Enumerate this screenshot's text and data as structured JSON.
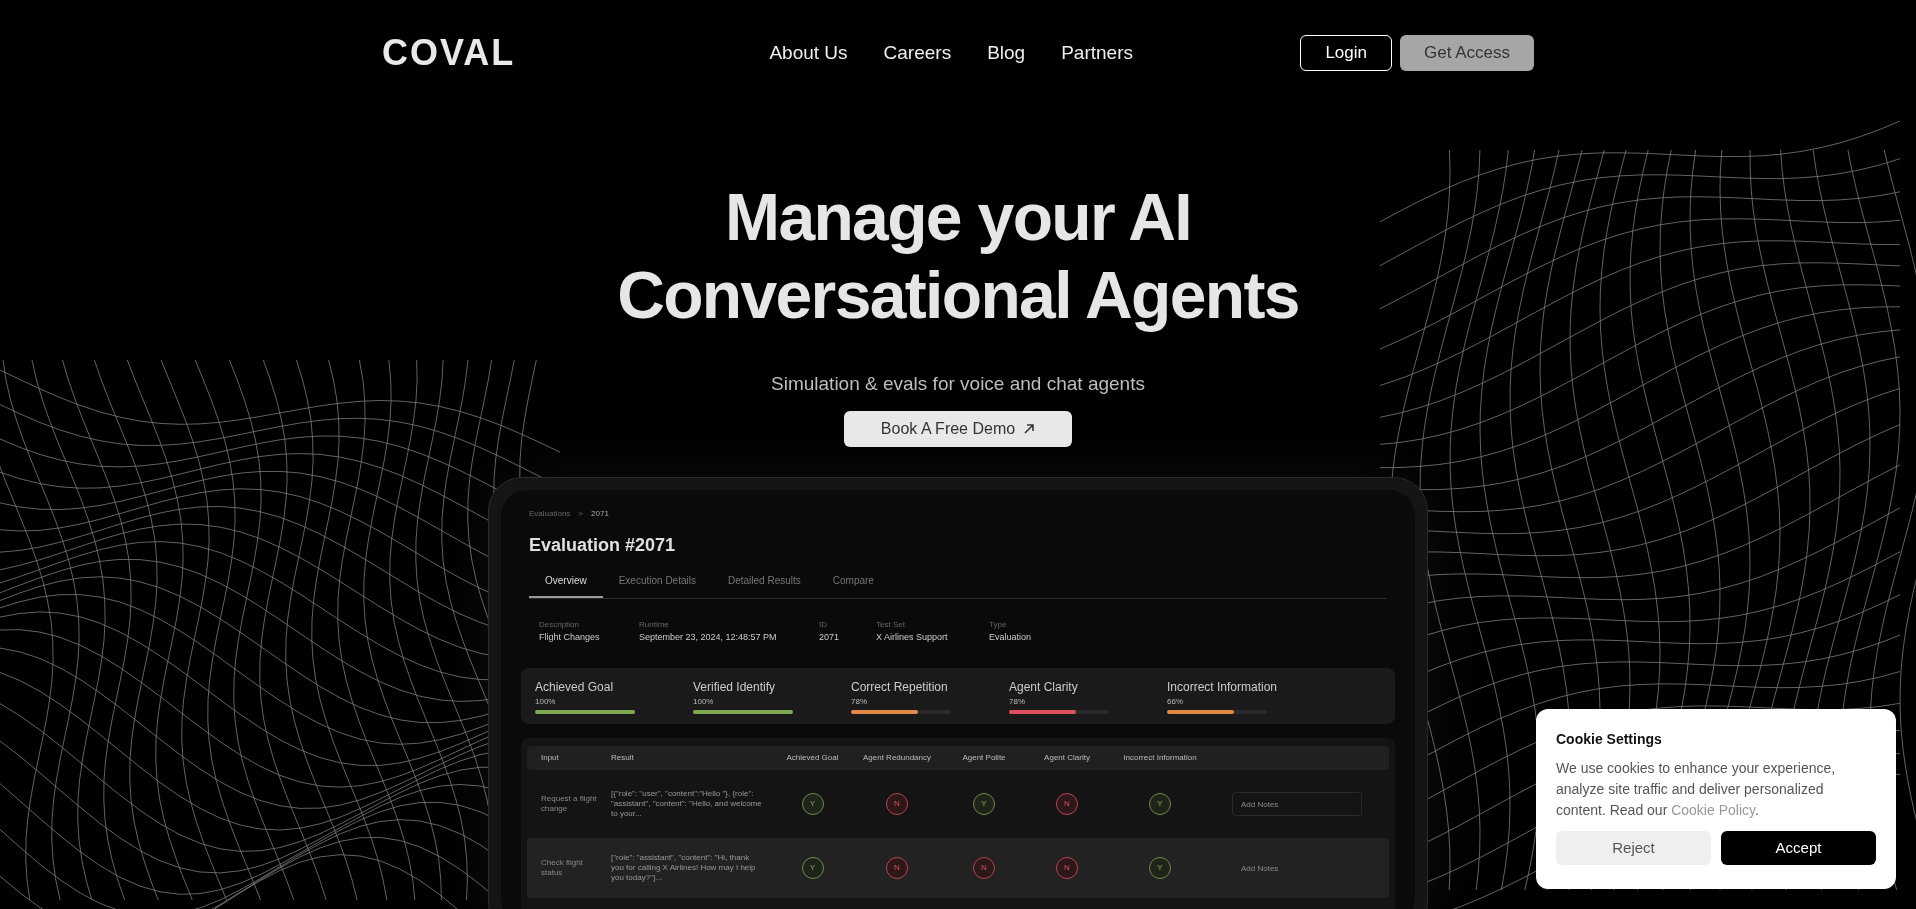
{
  "nav": {
    "logo": "COVAL",
    "links": [
      "About Us",
      "Careers",
      "Blog",
      "Partners"
    ],
    "login": "Login",
    "get_access": "Get Access"
  },
  "hero": {
    "title_lines": [
      "Manage your AI",
      "Conversational Agents"
    ],
    "subtitle": "Simulation & evals for voice and chat agents",
    "cta": "Book A Free Demo"
  },
  "dashboard": {
    "breadcrumb": [
      "Evaluations",
      ">",
      "2071"
    ],
    "title": "Evaluation #2071",
    "tabs": [
      {
        "label": "Overview",
        "selected": true
      },
      {
        "label": "Execution Details",
        "selected": false
      },
      {
        "label": "Detailed Results",
        "selected": false
      },
      {
        "label": "Compare",
        "selected": false
      }
    ],
    "info": [
      {
        "label": "Description",
        "value": "Flight Changes"
      },
      {
        "label": "Runtime",
        "value": "September 23, 2024, 12:48:57 PM"
      },
      {
        "label": "ID",
        "value": "2071"
      },
      {
        "label": "Test Set",
        "value": "X Airlines Support"
      },
      {
        "label": "Type",
        "value": "Evaluation"
      }
    ],
    "metrics": [
      {
        "name": "Achieved Goal",
        "reading": "100%",
        "level": 1,
        "color": "#7fa650"
      },
      {
        "name": "Verified Identify",
        "reading": "100%",
        "level": 1,
        "color": "#7fa650"
      },
      {
        "name": "Correct Repetition",
        "reading": "78%",
        "level": 0.67,
        "color": "#e08a45"
      },
      {
        "name": "Agent Clarity",
        "reading": "78%",
        "level": 0.67,
        "color": "#e0505a"
      },
      {
        "name": "Incorrect Information",
        "reading": "66%",
        "level": 0.67,
        "color": "#e08a45"
      }
    ],
    "table": {
      "columns": [
        "Input",
        "Result",
        "Achieved Goal",
        "Agent Redundancy",
        "Agent Polite",
        "Agent Clarity",
        "Incorrect Information"
      ],
      "rows": [
        {
          "input": "Request a flight change",
          "result": "[{\"role\": \"user\", \"content\":\"Hello \"}, {role\": \"assistant\", \"content\": \"Hello, and welcome to your...",
          "selected": false,
          "scores": [
            {
              "text": "Y",
              "pass": true
            },
            {
              "text": "N",
              "pass": false
            },
            {
              "text": "Y",
              "pass": true
            },
            {
              "text": "N",
              "pass": false
            },
            {
              "text": "Y",
              "pass": true
            }
          ],
          "notes": {
            "placeholder": "Add Notes"
          }
        },
        {
          "input": "Check flight status",
          "result": "[\"role\": \"assistant\", \"content\": \"Hi, thank you for calling X Airlines! How may I help you today?\"}...",
          "selected": true,
          "scores": [
            {
              "text": "Y",
              "pass": true
            },
            {
              "text": "N",
              "pass": false
            },
            {
              "text": "N",
              "pass": false
            },
            {
              "text": "N",
              "pass": false
            },
            {
              "text": "Y",
              "pass": true
            }
          ],
          "notes": {
            "placeholder": "Add Notes"
          }
        }
      ]
    }
  },
  "cookie": {
    "title": "Cookie Settings",
    "text": "We use cookies to enhance your experience, analyze site traffic and deliver personalized content. Read our ",
    "link": "Cookie Policy",
    "after": ".",
    "reject": "Reject",
    "accept": "Accept"
  }
}
